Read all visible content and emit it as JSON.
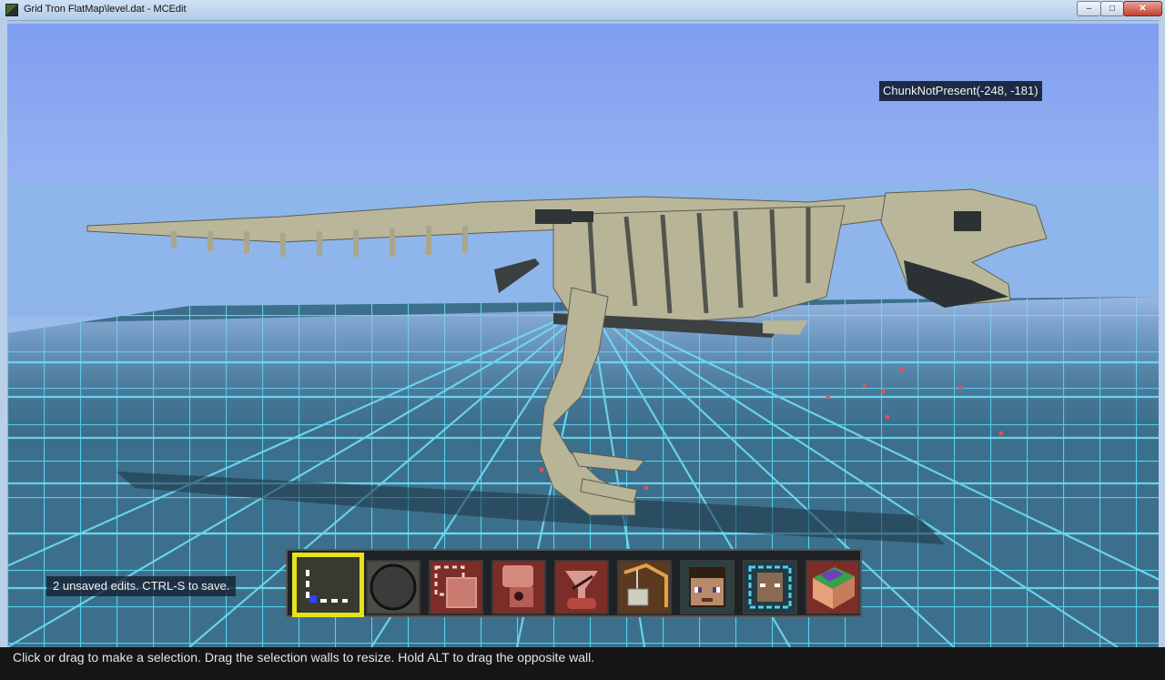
{
  "window": {
    "title": "Grid Tron FlatMap\\level.dat - MCEdit",
    "buttons": {
      "minimize": "–",
      "maximize": "□",
      "close": "✕"
    }
  },
  "viewport": {
    "tooltip": "ChunkNotPresent(-248, -181)",
    "unsaved_message": "2 unsaved edits.  CTRL-S to save."
  },
  "toolbar": {
    "selected_index": 0,
    "tools": [
      {
        "name": "Select",
        "icon": "select-corner-icon"
      },
      {
        "name": "Brush",
        "icon": "brush-circle-icon"
      },
      {
        "name": "Clone",
        "icon": "clone-icon"
      },
      {
        "name": "Fill",
        "icon": "fill-icon"
      },
      {
        "name": "Filter",
        "icon": "filter-icon"
      },
      {
        "name": "Import",
        "icon": "import-crane-icon"
      },
      {
        "name": "Player",
        "icon": "player-head-icon"
      },
      {
        "name": "Spawn",
        "icon": "spawn-icon"
      },
      {
        "name": "Chunk",
        "icon": "chunk-icon"
      }
    ]
  },
  "status": {
    "text": "Click or drag to make a selection. Drag the selection walls to resize. Hold ALT to drag the opposite wall."
  },
  "colors": {
    "grid": "#4fd3ee",
    "selection": "#e6e21d",
    "bone": "#b9b69a",
    "tooltip_bg": "#1d2a44"
  }
}
